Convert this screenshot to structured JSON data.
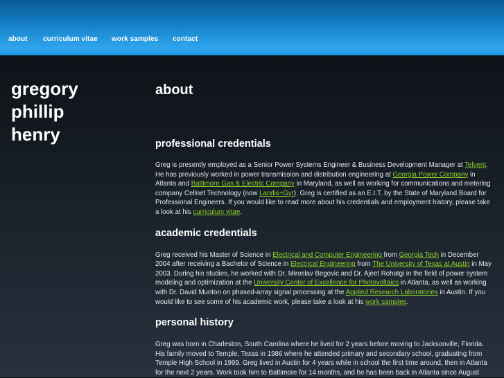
{
  "colors": {
    "link": "#8fd12a",
    "nav_gradient_top": "#0b5a93",
    "nav_gradient_bottom": "#30a6ee",
    "background": "#141a21"
  },
  "nav": {
    "about": "about",
    "cv": "curriculum vitae",
    "work": "work samples",
    "contact": "contact"
  },
  "name": {
    "line1": "gregory",
    "line2": "phillip",
    "line3": "henry"
  },
  "main": {
    "title": "about",
    "professional": {
      "heading": "professional credentials",
      "t1": "Greg is presently employed as a Senior Power Systems Engineer & Business Development Manager at ",
      "l1": "Telvent",
      "t2": ". He has previously worked in power transmission and distribution engineering at ",
      "l2": "Georgia Power Company",
      "t3": " in Atlanta and ",
      "l3": "Baltimore Gas & Electric Company",
      "t4": " in Maryland, as well as working for communications and metering company Cellnet Technology (now ",
      "l4": "Landis+Gyr",
      "t5": "). Greg is certified as an E.I.T. by the State of Maryland Board for Professional Engineers. If you would like to read more about his credentials and employment history, please take a look at his ",
      "l5": "curriculum vitae",
      "t6": "."
    },
    "academic": {
      "heading": "academic credentials",
      "t1": "Greg received his Master of Science in ",
      "l1": "Electrical and Computer Engineering ",
      "t2": "from ",
      "l2": "Georgia Tech",
      "t3": " in December 2004 after receiving a Bachelor of Science in ",
      "l3": "Electrical Engineering",
      "t4": " from ",
      "l4": "The University of Texas at Austin",
      "t5": " in May 2003. During his studies, he worked with Dr. Miroslav Begovic and Dr. Ajeet Rohatgi in the field of power system modeling and optimization at the ",
      "l5": "University Center of Excellence for Photovoltaics",
      "t6": " in Atlanta, as well as working with Dr. David Munton on phased-array signal processing at the ",
      "l6": "Applied Research Laboratories",
      "t7": " in Austin. If you would like to see some of his academic work, please take a look at his ",
      "l7": "work samples",
      "t8": "."
    },
    "personal": {
      "heading": "personal history",
      "text": "Greg was born in Charleston, South Carolina where he lived for 2 years before moving to Jacksonville, Florida. His family moved to Temple, Texas in 1986 where he attended primary and secondary school, graduating from Temple High School in 1999. Greg lived in Austin for 4 years while in school the first time around, then in Atlanta for the next 2 years. Work took him to Baltimore for 14 months, and he has been back in Atlanta since August"
    }
  }
}
